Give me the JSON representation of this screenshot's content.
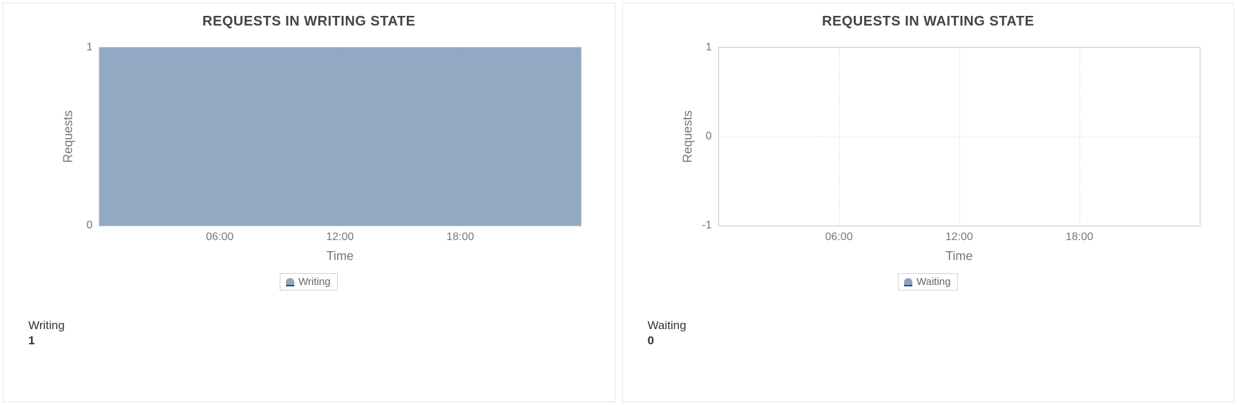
{
  "panels": [
    {
      "title": "REQUESTS IN WRITING STATE",
      "ylabel": "Requests",
      "xlabel": "Time",
      "legend": "Writing",
      "summaryLabel": "Writing",
      "summaryValue": "1"
    },
    {
      "title": "REQUESTS IN WAITING STATE",
      "ylabel": "Requests",
      "xlabel": "Time",
      "legend": "Waiting",
      "summaryLabel": "Waiting",
      "summaryValue": "0"
    }
  ],
  "chart_data": [
    {
      "type": "area",
      "title": "REQUESTS IN WRITING STATE",
      "xlabel": "Time",
      "ylabel": "Requests",
      "x_ticks": [
        "06:00",
        "12:00",
        "18:00"
      ],
      "y_ticks": [
        0,
        1
      ],
      "ylim": [
        0,
        1
      ],
      "series": [
        {
          "name": "Writing",
          "value_constant": 1
        }
      ],
      "legend_position": "bottom",
      "grid": true
    },
    {
      "type": "area",
      "title": "REQUESTS IN WAITING STATE",
      "xlabel": "Time",
      "ylabel": "Requests",
      "x_ticks": [
        "06:00",
        "12:00",
        "18:00"
      ],
      "y_ticks": [
        -1,
        0,
        1
      ],
      "ylim": [
        -1,
        1
      ],
      "series": [
        {
          "name": "Waiting",
          "value_constant": 0
        }
      ],
      "legend_position": "bottom",
      "grid": true
    }
  ]
}
